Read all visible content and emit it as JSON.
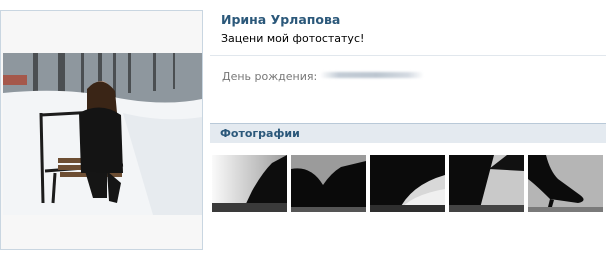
{
  "profile": {
    "name": "Ирина Урлапова",
    "status": "Зацени мой фотостатус!",
    "birthday_label": "День рождения:",
    "birthday_value": ""
  },
  "photos_section": {
    "title": "Фотографии",
    "count": 5
  },
  "colors": {
    "accent": "#2b587a",
    "header_bar": "#e4eaf0",
    "frame_border": "#c9d6e1"
  }
}
